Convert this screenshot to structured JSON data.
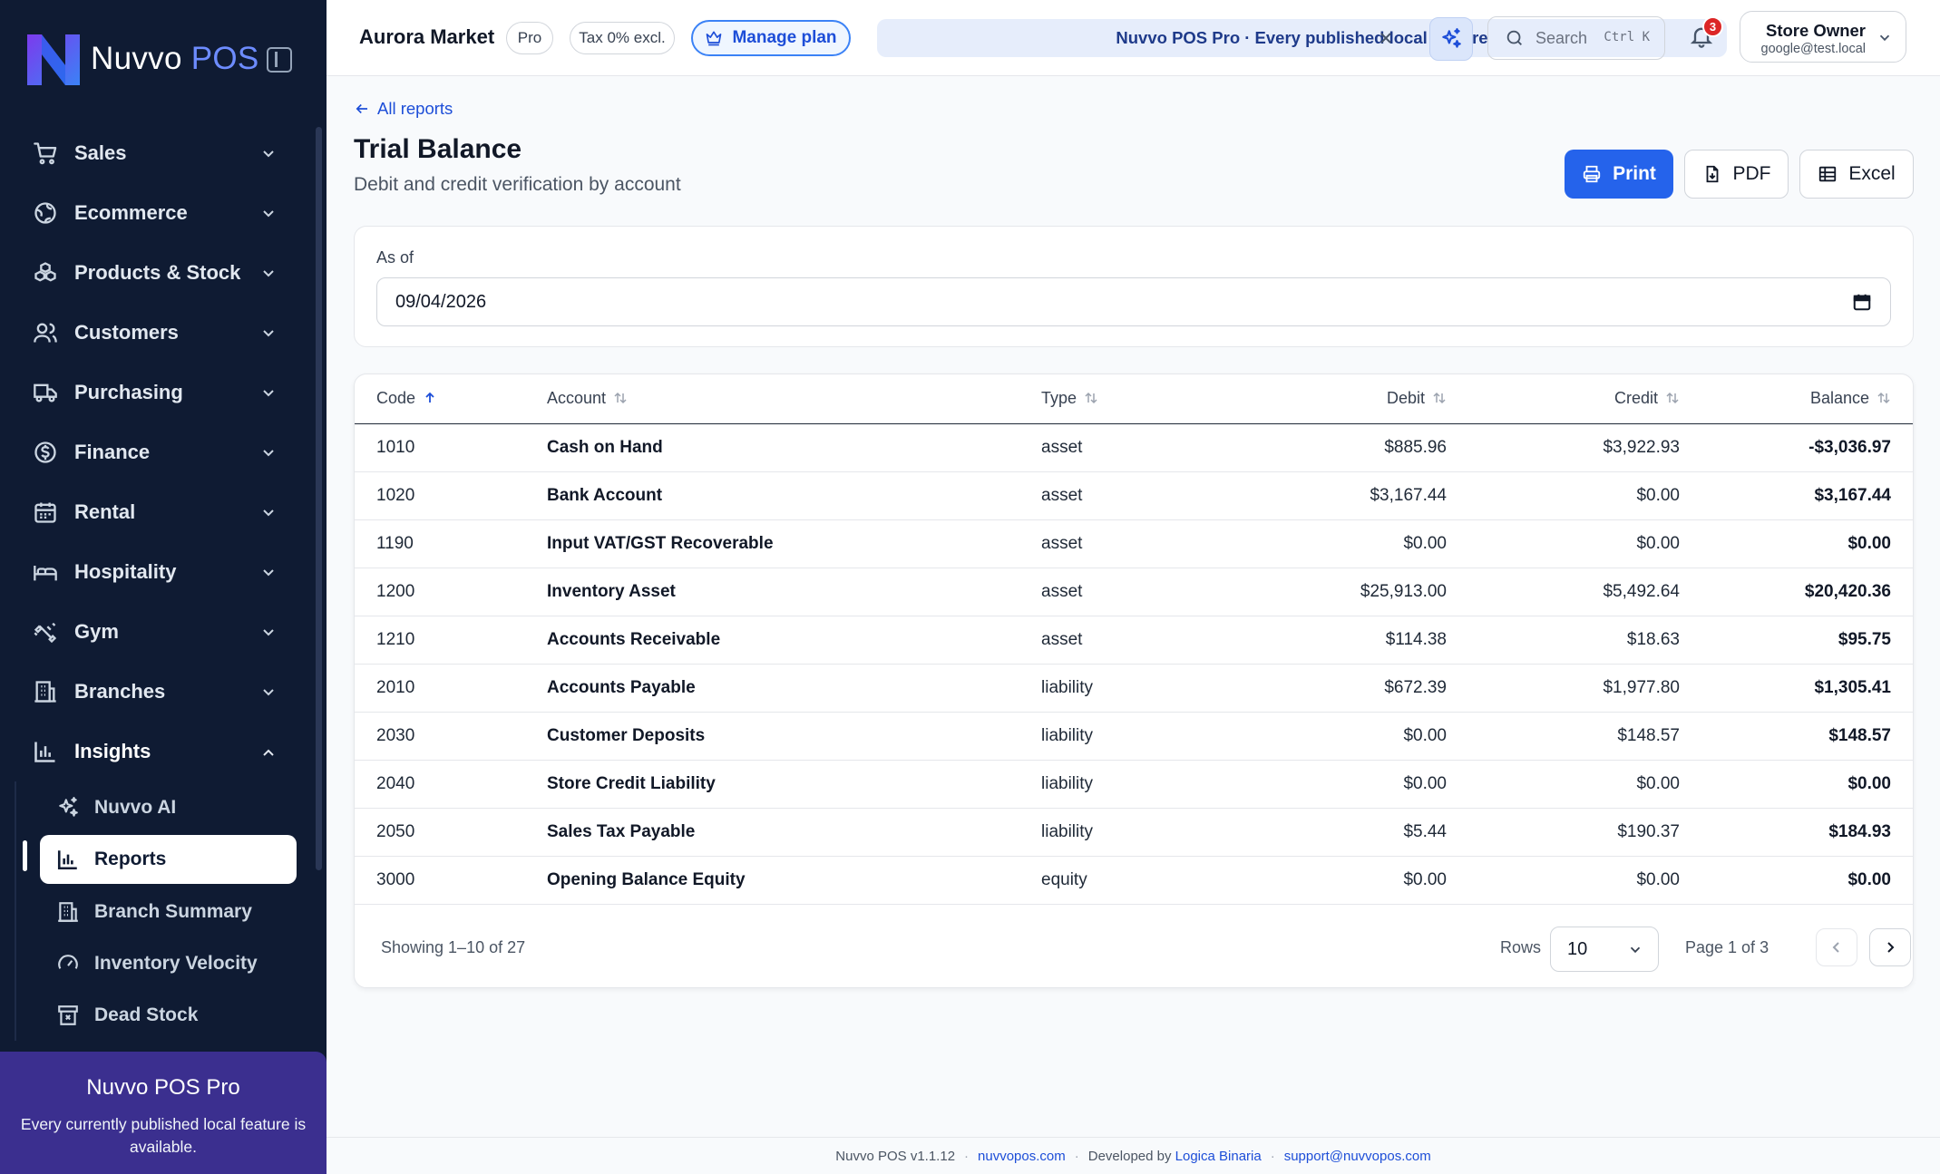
{
  "brand": {
    "name_part1": "Nuvvo",
    "name_part2": "POS"
  },
  "sidebar": {
    "items": [
      {
        "label": "Sales",
        "icon": "cart-icon"
      },
      {
        "label": "Ecommerce",
        "icon": "globe-icon"
      },
      {
        "label": "Products & Stock",
        "icon": "boxes-icon"
      },
      {
        "label": "Customers",
        "icon": "users-icon"
      },
      {
        "label": "Purchasing",
        "icon": "truck-icon"
      },
      {
        "label": "Finance",
        "icon": "dollar-circle-icon"
      },
      {
        "label": "Rental",
        "icon": "calendar-icon"
      },
      {
        "label": "Hospitality",
        "icon": "bed-icon"
      },
      {
        "label": "Gym",
        "icon": "dumbbell-icon"
      },
      {
        "label": "Branches",
        "icon": "building-icon"
      },
      {
        "label": "Insights",
        "icon": "bar-chart-icon",
        "expanded": true
      }
    ],
    "subitems": [
      {
        "label": "Nuvvo AI",
        "icon": "sparkles-icon"
      },
      {
        "label": "Reports",
        "icon": "bar-chart-icon",
        "active": true
      },
      {
        "label": "Branch Summary",
        "icon": "building-icon"
      },
      {
        "label": "Inventory Velocity",
        "icon": "gauge-icon"
      },
      {
        "label": "Dead Stock",
        "icon": "archive-x-icon"
      }
    ],
    "promo": {
      "title": "Nuvvo POS Pro",
      "text": "Every currently published local feature is available."
    }
  },
  "header": {
    "store_name": "Aurora Market",
    "plan_chip": "Pro",
    "tax_chip": "Tax 0% excl.",
    "manage_plan": "Manage plan",
    "banner": "Nuvvo POS Pro · Every published local feature",
    "search_placeholder": "Search",
    "search_shortcut": "Ctrl K",
    "notifications_count": "3",
    "user_name": "Store Owner",
    "user_email": "google@test.local"
  },
  "page": {
    "back_link": "All reports",
    "title": "Trial Balance",
    "subtitle": "Debit and credit verification by account",
    "actions": {
      "print": "Print",
      "pdf": "PDF",
      "excel": "Excel"
    },
    "filter": {
      "label": "As of",
      "date": "09/04/2026"
    }
  },
  "table": {
    "columns": {
      "code": "Code",
      "account": "Account",
      "type": "Type",
      "debit": "Debit",
      "credit": "Credit",
      "balance": "Balance"
    },
    "sort_column": "code",
    "rows": [
      {
        "code": "1010",
        "account": "Cash on Hand",
        "type": "asset",
        "debit": "$885.96",
        "credit": "$3,922.93",
        "balance": "-$3,036.97"
      },
      {
        "code": "1020",
        "account": "Bank Account",
        "type": "asset",
        "debit": "$3,167.44",
        "credit": "$0.00",
        "balance": "$3,167.44"
      },
      {
        "code": "1190",
        "account": "Input VAT/GST Recoverable",
        "type": "asset",
        "debit": "$0.00",
        "credit": "$0.00",
        "balance": "$0.00"
      },
      {
        "code": "1200",
        "account": "Inventory Asset",
        "type": "asset",
        "debit": "$25,913.00",
        "credit": "$5,492.64",
        "balance": "$20,420.36"
      },
      {
        "code": "1210",
        "account": "Accounts Receivable",
        "type": "asset",
        "debit": "$114.38",
        "credit": "$18.63",
        "balance": "$95.75"
      },
      {
        "code": "2010",
        "account": "Accounts Payable",
        "type": "liability",
        "debit": "$672.39",
        "credit": "$1,977.80",
        "balance": "$1,305.41"
      },
      {
        "code": "2030",
        "account": "Customer Deposits",
        "type": "liability",
        "debit": "$0.00",
        "credit": "$148.57",
        "balance": "$148.57"
      },
      {
        "code": "2040",
        "account": "Store Credit Liability",
        "type": "liability",
        "debit": "$0.00",
        "credit": "$0.00",
        "balance": "$0.00"
      },
      {
        "code": "2050",
        "account": "Sales Tax Payable",
        "type": "liability",
        "debit": "$5.44",
        "credit": "$190.37",
        "balance": "$184.93"
      },
      {
        "code": "3000",
        "account": "Opening Balance Equity",
        "type": "equity",
        "debit": "$0.00",
        "credit": "$0.00",
        "balance": "$0.00"
      }
    ],
    "footer": {
      "showing": "Showing 1–10 of 27",
      "rows_label": "Rows",
      "rows_value": "10",
      "page_label": "Page 1 of 3"
    }
  },
  "footer": {
    "version": "Nuvvo POS v1.1.12",
    "site": "nuvvopos.com",
    "developed_by": "Developed by",
    "developer": "Logica Binaria",
    "support": "support@nuvvopos.com"
  },
  "colors": {
    "sidebar_bg": "#0f1b33",
    "accent": "#2563eb",
    "promo_bg": "#3b2f8f",
    "badge": "#dc2626"
  }
}
